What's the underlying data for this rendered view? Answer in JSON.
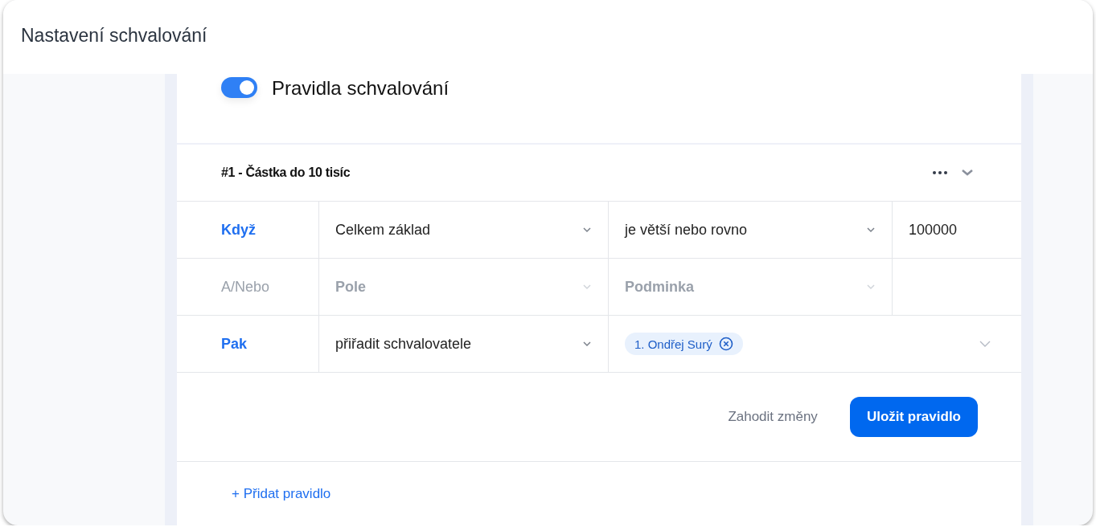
{
  "window": {
    "title": "Nastavení schvalování"
  },
  "rules_toggle": {
    "label": "Pravidla schvalování",
    "on": true
  },
  "rule": {
    "title": "#1 - Částka do 10 tisíc",
    "rows": [
      {
        "kind": "condition",
        "label": "Když",
        "disabled": false,
        "field": {
          "value": "Celkem základ"
        },
        "operator": {
          "value": "je větší nebo rovno"
        },
        "amount": {
          "value": "100000"
        }
      },
      {
        "kind": "condition",
        "label": "A/Nebo",
        "disabled": true,
        "field": {
          "placeholder": "Pole"
        },
        "operator": {
          "placeholder": "Podminka"
        },
        "amount": {}
      },
      {
        "kind": "action",
        "label": "Pak",
        "disabled": false,
        "action": {
          "value": "přiřadit schvalovatele"
        },
        "approvers": [
          {
            "name": "1. Ondřej Surý"
          }
        ]
      }
    ],
    "discard_button": "Zahodit změny",
    "save_button": "Uložit pravidlo"
  },
  "add_rule_link": "+ Přidat pravidlo"
}
